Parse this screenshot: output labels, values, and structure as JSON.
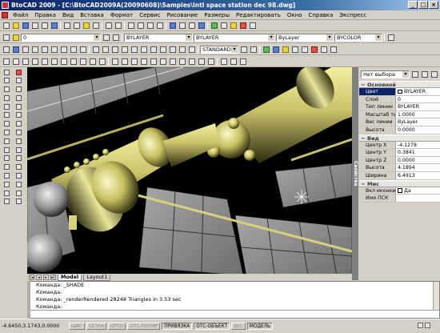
{
  "window": {
    "title": "BtoCAD 2009 - [C:\\BtoCAD2009A(20090608)\\Samples\\Intl space station dec 98.dwg]",
    "buttons": [
      "_",
      "□",
      "×"
    ]
  },
  "menu": {
    "items": [
      "Файл",
      "Правка",
      "Вид",
      "Вставка",
      "Формат",
      "Сервис",
      "Рисование",
      "Размеры",
      "Редактировать",
      "Окно",
      "Справка",
      "Экспресс"
    ]
  },
  "toolbar_row2": {
    "layer_value": "0",
    "color_value": "BYLAYER",
    "linetype_value": "BYLAYER",
    "lineweight_value": "ByLayer",
    "plotstyle_value": "BYCOLOR"
  },
  "toolbar_row3": {
    "textstyle_value": "STANDARD"
  },
  "properties": {
    "palette_title": "Свойства",
    "selection_value": "Нет выбора",
    "categories": [
      {
        "name": "Основной",
        "rows": [
          {
            "key": "Цвет",
            "value": "BYLAYER"
          },
          {
            "key": "Слой",
            "value": "0"
          },
          {
            "key": "Тип линии",
            "value": "BYLAYER"
          },
          {
            "key": "Масштаб тип",
            "value": "1.0000"
          },
          {
            "key": "Вес линии",
            "value": "ByLayer"
          },
          {
            "key": "Высота",
            "value": "0.0000"
          }
        ]
      },
      {
        "name": "Вид",
        "rows": [
          {
            "key": "Центр X",
            "value": "-4.1278"
          },
          {
            "key": "Центр Y",
            "value": "0.3841"
          },
          {
            "key": "Центр Z",
            "value": "0.0000"
          },
          {
            "key": "Высота",
            "value": "4.1894"
          },
          {
            "key": "Ширина",
            "value": "6.4913"
          }
        ]
      },
      {
        "name": "Мис",
        "rows": [
          {
            "key": "Вкл иконки ПС",
            "value": "Да"
          },
          {
            "key": "Имя ПСК",
            "value": ""
          }
        ]
      }
    ]
  },
  "layout_tabs": [
    "Model",
    "Layout1"
  ],
  "command": {
    "lines": [
      "Команда: _SHADE",
      "Команда:",
      "Команда: _renderRendered 28248 Triangles in 3.53 sec",
      "Команда:"
    ],
    "input": ""
  },
  "status": {
    "coords": "-4.6450,3.1743,0.0000",
    "buttons": [
      {
        "label": "ШАГ",
        "on": false
      },
      {
        "label": "СЕТКА",
        "on": false
      },
      {
        "label": "ОРТО",
        "on": false
      },
      {
        "label": "ОТС-ПОЛЯР",
        "on": false
      },
      {
        "label": "ПРИВЯЗКА",
        "on": true
      },
      {
        "label": "ОТС-ОБЪЕКТ",
        "on": true
      },
      {
        "label": "ВЕС",
        "on": false
      },
      {
        "label": "МОДЕЛЬ",
        "on": true
      }
    ]
  },
  "icons": {
    "row1": [
      "new-icon",
      "open-icon",
      "save-icon",
      "print-icon",
      "preview-icon",
      "publish-icon",
      "cut-icon",
      "copy-icon",
      "paste-icon",
      "matchprop-icon",
      "undo-icon",
      "redo-icon",
      "pan-icon",
      "zoom-icon",
      "zoom-window-icon",
      "zoom-prev-icon",
      "properties-icon",
      "designcenter-icon",
      "toolpalette-icon",
      "help-icon"
    ],
    "left": [
      "line-icon",
      "construction-line-icon",
      "polyline-icon",
      "polygon-icon",
      "rectangle-icon",
      "arc-icon",
      "circle-icon",
      "spline-icon",
      "ellipse-icon",
      "insert-block-icon",
      "make-block-icon",
      "point-icon",
      "hatch-icon",
      "region-icon",
      "table-icon",
      "text-icon",
      "erase-icon",
      "copy-object-icon",
      "mirror-icon",
      "offset-icon",
      "array-icon",
      "move-icon",
      "rotate-icon",
      "scale-icon",
      "stretch-icon",
      "trim-icon",
      "extend-icon",
      "break-icon",
      "chamfer-icon",
      "fillet-icon",
      "explode-icon",
      "text-a-icon"
    ]
  }
}
